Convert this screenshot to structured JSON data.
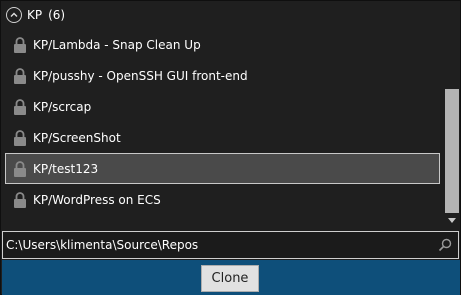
{
  "group": {
    "label": "KP",
    "count": "(6)"
  },
  "repos": [
    {
      "label": "KP/Lambda - Snap Clean Up",
      "icon": "lock-icon"
    },
    {
      "label": "KP/pusshy - OpenSSH GUI front-end",
      "icon": "lock-icon"
    },
    {
      "label": "KP/scrcap",
      "icon": "lock-icon"
    },
    {
      "label": "KP/ScreenShot",
      "icon": "lock-icon"
    },
    {
      "label": "KP/test123",
      "icon": "lock-icon",
      "selected": true
    },
    {
      "label": "KP/WordPress on ECS",
      "icon": "lock-icon"
    }
  ],
  "path": {
    "value": "C:\\Users\\klimenta\\Source\\Repos",
    "icon": "search-icon"
  },
  "footer": {
    "clone_label": "Clone"
  },
  "colors": {
    "background": "#1f1f1f",
    "selected_row": "#4a4a4a",
    "footer": "#0e4f7a",
    "button": "#e1e1e1"
  }
}
